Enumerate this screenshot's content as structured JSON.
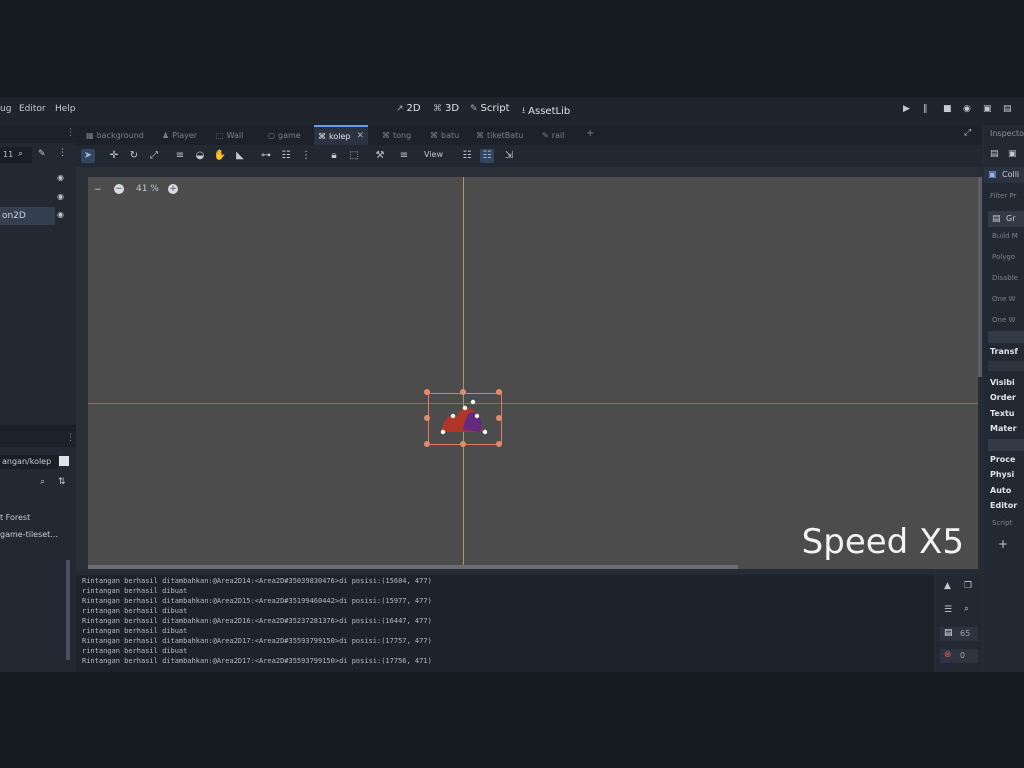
{
  "menu": {
    "items": [
      "ug",
      "Editor",
      "Help"
    ]
  },
  "workspaces": [
    {
      "icon": "2d-icon",
      "label": "2D"
    },
    {
      "icon": "3d-icon",
      "label": "3D"
    },
    {
      "icon": "script-icon",
      "label": "Script"
    },
    {
      "icon": "assetlib-icon",
      "label": "AssetLib"
    }
  ],
  "scene_tabs": [
    {
      "label": "background",
      "active": false
    },
    {
      "label": "Player",
      "active": false
    },
    {
      "label": "Wall",
      "active": false
    },
    {
      "label": "game",
      "active": false
    },
    {
      "label": "kolep",
      "active": true
    },
    {
      "label": "tong",
      "active": false
    },
    {
      "label": "batu",
      "active": false
    },
    {
      "label": "tiketBatu",
      "active": false
    },
    {
      "label": "rail",
      "active": false
    }
  ],
  "toolbar": {
    "view_label": "View"
  },
  "scene_tree": {
    "filter_text": "11",
    "selected_node": "on2D"
  },
  "viewport": {
    "zoom": "41 %",
    "speed_overlay": "Speed X5"
  },
  "filesystem": {
    "path": "angan/kolep",
    "items": [
      "t Forest",
      "game-tileset..."
    ]
  },
  "output_lines": [
    "Rintangan berhasil ditambahkan:@Area2D14:<Area2D#35039830476>di posisi:(15604, 477)",
    "rintangan berhasil dibuat",
    "Rintangan berhasil ditambahkan:@Area2D15:<Area2D#35199460442>di posisi:(15977, 477)",
    "rintangan berhasil dibuat",
    "Rintangan berhasil ditambahkan:@Area2D16:<Area2D#35237281376>di posisi:(16447, 477)",
    "rintangan berhasil dibuat",
    "Rintangan berhasil ditambahkan:@Area2D17:<Area2D#35593799150>di posisi:(17757, 477)",
    "rintangan berhasil dibuat",
    "Rintangan berhasil ditambahkan:@Area2D17:<Area2D#35593799150>di posisi:(17756, 471)"
  ],
  "output_counts": {
    "messages": "65",
    "errors": "0"
  },
  "inspector": {
    "tab": "Inspector",
    "node_label": "Colli",
    "filter": "Filter Pr",
    "polygon_header": "Gr",
    "props": [
      "Build M",
      "Polygo",
      "Disable",
      "One W",
      "One W"
    ],
    "sections": [
      "Transf",
      "Visibi",
      "Order",
      "Textu",
      "Mater",
      "Proce",
      "Physi",
      "Auto",
      "Editor"
    ],
    "script_label": "Script"
  },
  "colors": {
    "accent": "#699ce8",
    "viewport_bg": "#4c4c4c",
    "selection_box": "#e07c5c",
    "guide_line": "#c6a96a"
  }
}
